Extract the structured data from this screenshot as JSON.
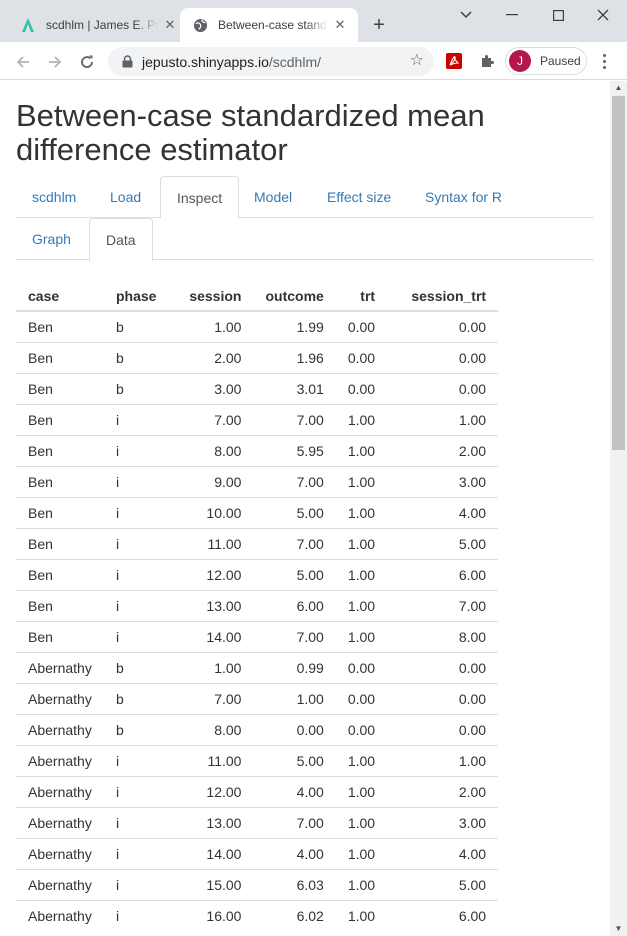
{
  "browser": {
    "tabs": [
      {
        "title": "scdhlm | James E. Pu",
        "active": false
      },
      {
        "title": "Between-case standa",
        "active": true
      }
    ],
    "url_host": "jepusto.shinyapps.io",
    "url_path": "/scdhlm/",
    "profile_initial": "J",
    "profile_status": "Paused"
  },
  "page": {
    "title": "Between-case standardized mean difference estimator",
    "tabs": [
      "scdhlm",
      "Load",
      "Inspect",
      "Model",
      "Effect size",
      "Syntax for R"
    ],
    "active_tab": "Inspect",
    "subtabs": [
      "Graph",
      "Data"
    ],
    "active_subtab": "Data"
  },
  "table": {
    "columns": [
      "case",
      "phase",
      "session",
      "outcome",
      "trt",
      "session_trt"
    ],
    "rows": [
      [
        "Ben",
        "b",
        "1.00",
        "1.99",
        "0.00",
        "0.00"
      ],
      [
        "Ben",
        "b",
        "2.00",
        "1.96",
        "0.00",
        "0.00"
      ],
      [
        "Ben",
        "b",
        "3.00",
        "3.01",
        "0.00",
        "0.00"
      ],
      [
        "Ben",
        "i",
        "7.00",
        "7.00",
        "1.00",
        "1.00"
      ],
      [
        "Ben",
        "i",
        "8.00",
        "5.95",
        "1.00",
        "2.00"
      ],
      [
        "Ben",
        "i",
        "9.00",
        "7.00",
        "1.00",
        "3.00"
      ],
      [
        "Ben",
        "i",
        "10.00",
        "5.00",
        "1.00",
        "4.00"
      ],
      [
        "Ben",
        "i",
        "11.00",
        "7.00",
        "1.00",
        "5.00"
      ],
      [
        "Ben",
        "i",
        "12.00",
        "5.00",
        "1.00",
        "6.00"
      ],
      [
        "Ben",
        "i",
        "13.00",
        "6.00",
        "1.00",
        "7.00"
      ],
      [
        "Ben",
        "i",
        "14.00",
        "7.00",
        "1.00",
        "8.00"
      ],
      [
        "Abernathy",
        "b",
        "1.00",
        "0.99",
        "0.00",
        "0.00"
      ],
      [
        "Abernathy",
        "b",
        "7.00",
        "1.00",
        "0.00",
        "0.00"
      ],
      [
        "Abernathy",
        "b",
        "8.00",
        "0.00",
        "0.00",
        "0.00"
      ],
      [
        "Abernathy",
        "i",
        "11.00",
        "5.00",
        "1.00",
        "1.00"
      ],
      [
        "Abernathy",
        "i",
        "12.00",
        "4.00",
        "1.00",
        "2.00"
      ],
      [
        "Abernathy",
        "i",
        "13.00",
        "7.00",
        "1.00",
        "3.00"
      ],
      [
        "Abernathy",
        "i",
        "14.00",
        "4.00",
        "1.00",
        "4.00"
      ],
      [
        "Abernathy",
        "i",
        "15.00",
        "6.03",
        "1.00",
        "5.00"
      ],
      [
        "Abernathy",
        "i",
        "16.00",
        "6.02",
        "1.00",
        "6.00"
      ]
    ]
  },
  "colors": {
    "link": "#337ab7",
    "titlebar": "#dee1e6",
    "avatar": "#b5164e",
    "pdf_ext": "#cc0000",
    "shiny_favicon": "#2fc0a9"
  }
}
